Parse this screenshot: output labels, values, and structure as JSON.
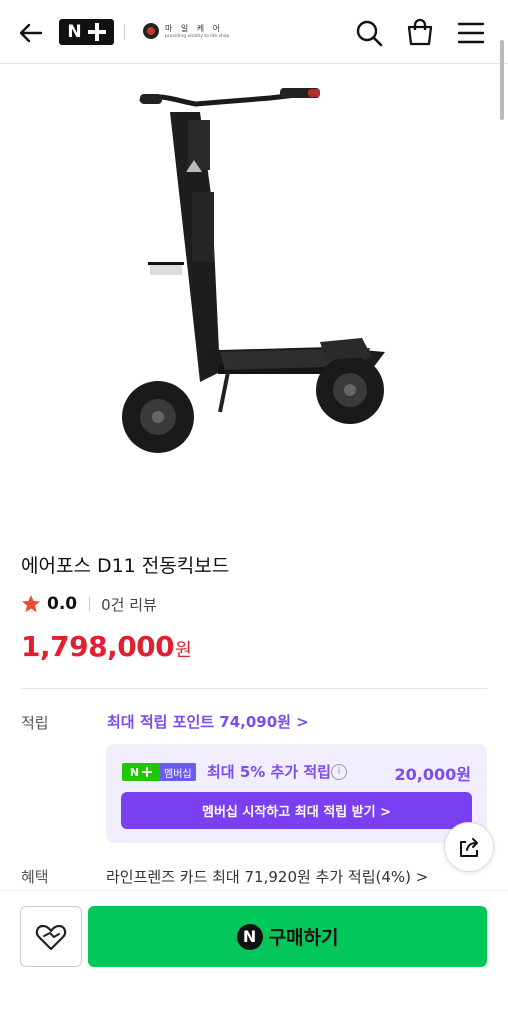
{
  "header": {
    "logo_n": "N",
    "store_name": "마 일 케 어",
    "store_tagline": "providing vitality to life shop"
  },
  "product": {
    "title": "에어포스 D11 전동킥보드",
    "rating": "0.0",
    "review_count": "0건 리뷰",
    "price": "1,798,000",
    "price_unit": "원"
  },
  "points": {
    "label": "적립",
    "link": "최대 적립 포인트 74,090원 >",
    "membership": {
      "badge_n": "N",
      "badge_label": "멤버십",
      "text": "최대 5% 추가 적립",
      "info": "i",
      "amount": "20,000원",
      "button": "멤버십 시작하고 최대 적립 받기 >"
    }
  },
  "benefit": {
    "label": "혜택",
    "text": "라인프렌즈 카드 최대 71,920원 추가 적립(4%) >"
  },
  "bottom_bar": {
    "buy_icon": "N",
    "buy_label": "구매하기"
  },
  "colors": {
    "price": "#e0202e",
    "accent_purple": "#7b4cf0",
    "buy_green": "#03c75a",
    "star": "#f04a3a"
  },
  "icons": [
    "back-arrow-icon",
    "search-icon",
    "cart-icon",
    "menu-icon",
    "star-icon",
    "share-icon",
    "heart-icon",
    "info-icon"
  ]
}
